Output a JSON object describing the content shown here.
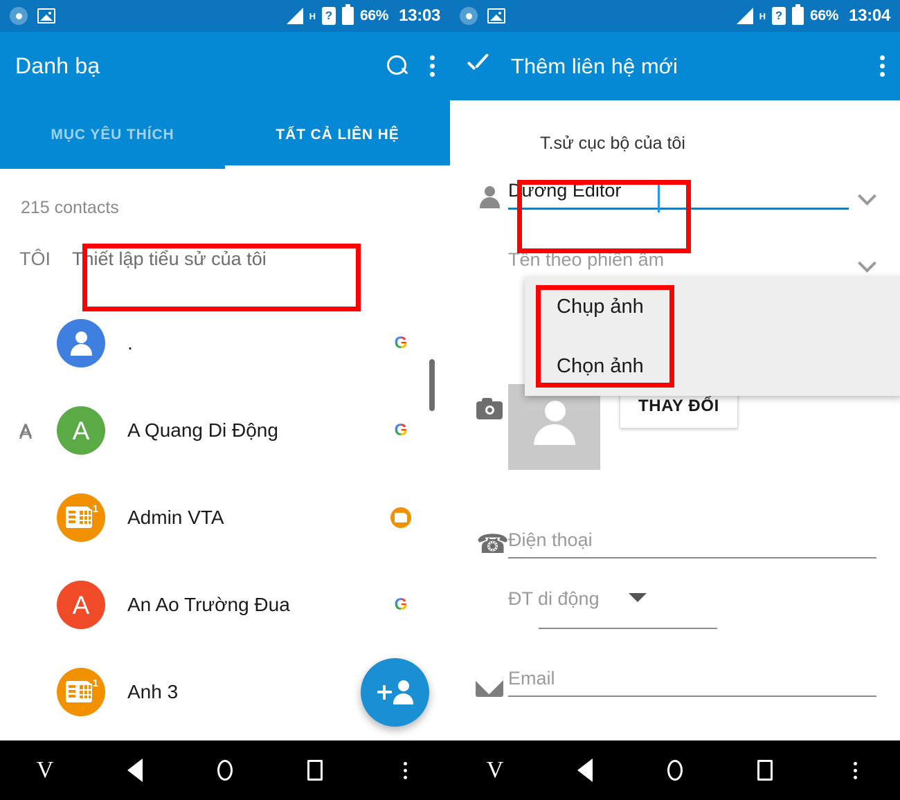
{
  "left": {
    "status_bar": {
      "carrier_net": "H",
      "battery_pct": "66%",
      "time": "13:03",
      "icons": [
        "record-icon",
        "gallery-icon",
        "signal-icon",
        "sim-icon",
        "battery-icon"
      ]
    },
    "app_title": "Danh bạ",
    "tabs": [
      {
        "label": "MỤC YÊU THÍCH",
        "active": false
      },
      {
        "label": "TẤT CẢ LIÊN HỆ",
        "active": true
      }
    ],
    "contacts_count": "215 contacts",
    "sections": [
      {
        "index": "TÔI",
        "me_action": "Thiết lập tiểu sử của tôi"
      },
      {
        "index": "A"
      }
    ],
    "rows": [
      {
        "index": "",
        "avatar_kind": "person",
        "avatar_color": "#3f7fe0",
        "letter": "",
        "name": ".",
        "badge": "google-icon"
      },
      {
        "index": "A",
        "avatar_kind": "letter",
        "avatar_color": "#5aab46",
        "letter": "A",
        "name": "A Quang Di Động",
        "badge": "google-icon"
      },
      {
        "index": "",
        "avatar_kind": "sim",
        "avatar_color": "#f29100",
        "letter": "",
        "name": "Admin VTA",
        "badge": "sim-icon"
      },
      {
        "index": "",
        "avatar_kind": "letter",
        "avatar_color": "#f04b28",
        "letter": "A",
        "name": "An Ao Trường Đua",
        "badge": "google-icon"
      },
      {
        "index": "",
        "avatar_kind": "sim",
        "avatar_color": "#f29100",
        "letter": "",
        "name": "Anh 3",
        "badge": ""
      }
    ],
    "fab_label": "add-contact-icon"
  },
  "right": {
    "status_bar": {
      "carrier_net": "H",
      "battery_pct": "66%",
      "time": "13:04"
    },
    "app_title": "Thêm liên hệ mới",
    "account_label": "T.sử cục bộ của tôi",
    "name_field": {
      "value": "Dương Editor",
      "has_cursor": true
    },
    "phonetic_field": {
      "placeholder": "Tên theo phiên âm"
    },
    "photo_button": "THAY ĐỔI",
    "phone_field": {
      "placeholder": "Điện thoại"
    },
    "phone_type_field": {
      "value": "ĐT di động"
    },
    "email_field": {
      "placeholder": "Email"
    },
    "popup_menu": {
      "items": [
        "Chụp ảnh",
        "Chọn ảnh"
      ]
    }
  },
  "nav_bar": {
    "buttons": [
      "v-key",
      "back-icon",
      "home-icon",
      "recents-icon",
      "menu-icon"
    ]
  },
  "colors": {
    "app_bar_blue": "#0589d4",
    "status_bar_blue": "#0b76be",
    "annotation_red": "#ff0000",
    "accent_underline": "#1a7cb5"
  }
}
